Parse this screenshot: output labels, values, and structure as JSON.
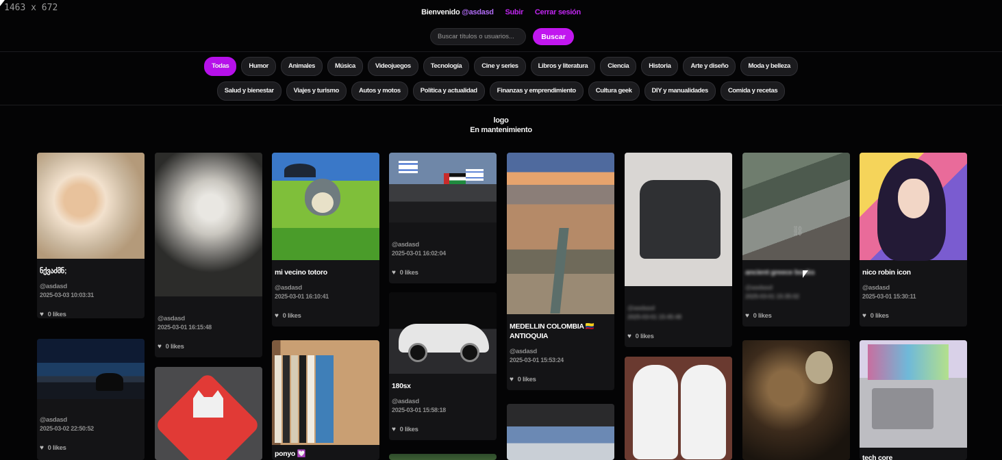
{
  "overlay": {
    "dimensions_text": "1463 x 672"
  },
  "header": {
    "welcome": "Bienvenido",
    "username": "@asdasd",
    "upload": "Subir",
    "logout": "Cerrar sesión",
    "search_placeholder": "Buscar títulos o usuarios...",
    "search_button": "Buscar"
  },
  "categories": {
    "row1": [
      "Todas",
      "Humor",
      "Animales",
      "Música",
      "Videojuegos",
      "Tecnología",
      "Cine y series",
      "Libros y literatura",
      "Ciencia",
      "Historia",
      "Arte y diseño",
      "Moda y belleza"
    ],
    "row2": [
      "Salud y bienestar",
      "Viajes y turismo",
      "Autos y motos",
      "Política y actualidad",
      "Finanzas y emprendimiento",
      "Cultura geek",
      "DIY y manualidades",
      "Comida y recetas"
    ],
    "active": "Todas"
  },
  "banner": {
    "logo": "logo",
    "status": "En mantenimiento"
  },
  "posts": [
    {
      "title": "ნქვაძმნ;",
      "user": "@asdasd",
      "date": "2025-03-03 10:03:31",
      "likes": "0 likes"
    },
    {
      "title": "",
      "user": "@asdasd",
      "date": "2025-03-01 16:15:48",
      "likes": "0 likes"
    },
    {
      "title": "mi vecino totoro",
      "user": "@asdasd",
      "date": "2025-03-01 16:10:41",
      "likes": "0 likes"
    },
    {
      "title": "",
      "user": "@asdasd",
      "date": "2025-03-01 16:02:04",
      "likes": "0 likes"
    },
    {
      "title": "MEDELLIN COLOMBIA 🇨🇴 ANTIOQUIA",
      "user": "@asdasd",
      "date": "2025-03-01 15:53:24",
      "likes": "0 likes"
    },
    {
      "title": "",
      "user": "@asdasd",
      "date": "2025-03-01 15:45:48",
      "likes": "0 likes"
    },
    {
      "title": "ancient greece books",
      "user": "@asdasd",
      "date": "2025-03-01 15:35:02",
      "likes": "0 likes"
    },
    {
      "title": "nico robin icon",
      "user": "@asdasd",
      "date": "2025-03-01 15:30:11",
      "likes": "0 likes"
    },
    {
      "title": "",
      "user": "@asdasd",
      "date": "2025-03-02 22:50:52",
      "likes": "0 likes"
    },
    {
      "title": "180sx",
      "user": "@asdasd",
      "date": "2025-03-01 15:58:18",
      "likes": "0 likes"
    },
    {
      "title": "ponyo 💟",
      "user": "",
      "date": "",
      "likes": ""
    },
    {
      "title": "tech core",
      "user": "",
      "date": "",
      "likes": ""
    }
  ]
}
